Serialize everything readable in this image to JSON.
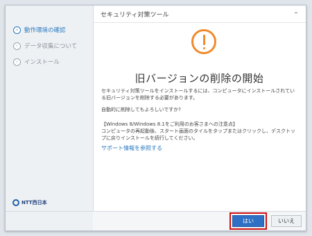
{
  "window": {
    "title": "セキュリティ対策ツール",
    "minimize_label": "–"
  },
  "sidebar": {
    "steps": [
      {
        "label": "動作環境の確認",
        "glyph": "›",
        "active": true
      },
      {
        "label": "データ収集について",
        "glyph": "›",
        "active": false
      },
      {
        "label": "インストール",
        "glyph": "›",
        "active": false
      }
    ],
    "logo_text": "NTT西日本"
  },
  "content": {
    "icon": "warning-exclamation-icon",
    "heading": "旧バージョンの削除の開始",
    "paragraph1": "セキュリティ対策ツールをインストールするには、コンピュータにインストールされている旧バージョンを削除する必要があります。",
    "paragraph2": "自動的に削除してもよろしいですか?",
    "notice_title": "【Windows 8/Windows 8.1をご利用のお客さまへの注意点】",
    "notice_body": "コンピュータの再起動後、スタート画面のタイルをタップまたはクリックし、デスクトップに戻りインストールを続行してください。",
    "support_link": "サポート情報を参照する"
  },
  "footer": {
    "yes_label": "はい",
    "no_label": "いいえ"
  },
  "colors": {
    "accent": "#2f6fc4",
    "warning": "#f08a2c",
    "highlight": "#d01010"
  }
}
